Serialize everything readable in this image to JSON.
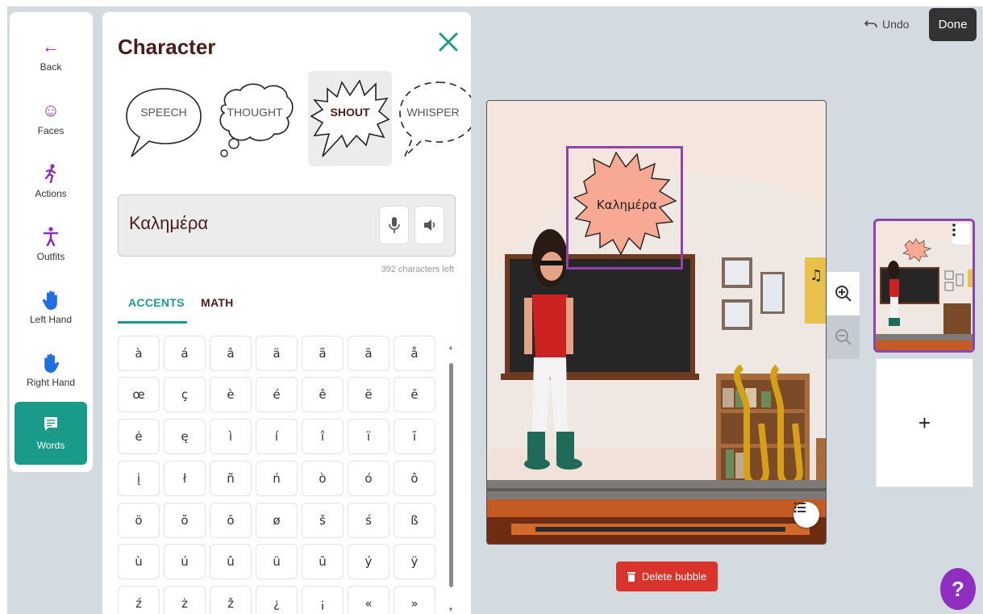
{
  "nav": {
    "items": [
      {
        "label": "Back",
        "icon": "back-arrow-icon"
      },
      {
        "label": "Faces",
        "icon": "face-icon"
      },
      {
        "label": "Actions",
        "icon": "running-person-icon"
      },
      {
        "label": "Outfits",
        "icon": "person-icon"
      },
      {
        "label": "Left Hand",
        "icon": "hand-icon"
      },
      {
        "label": "Right Hand",
        "icon": "hand-icon"
      },
      {
        "label": "Words",
        "icon": "speech-bubble-icon"
      }
    ],
    "active": "Words"
  },
  "panel": {
    "title": "Character",
    "bubble_types": [
      "SPEECH",
      "THOUGHT",
      "SHOUT",
      "WHISPER"
    ],
    "selected_bubble": "SHOUT",
    "text_value": "Καλημέρα",
    "chars_left": "392 characters left",
    "tabs": [
      "ACCENTS",
      "MATH"
    ],
    "active_tab": "ACCENTS",
    "accent_keys": [
      [
        "à",
        "á",
        "â",
        "ä",
        "ã",
        "ā",
        "å"
      ],
      [
        "œ",
        "ç",
        "è",
        "é",
        "ê",
        "ë",
        "ē"
      ],
      [
        "ė",
        "ę",
        "ì",
        "í",
        "î",
        "ï",
        "ī"
      ],
      [
        "į",
        "ł",
        "ñ",
        "ń",
        "ò",
        "ó",
        "ô"
      ],
      [
        "ö",
        "õ",
        "ō",
        "ø",
        "š",
        "ś",
        "ß"
      ],
      [
        "ù",
        "ú",
        "û",
        "ü",
        "ū",
        "ý",
        "ÿ"
      ],
      [
        "ź",
        "ż",
        "ž",
        "¿",
        "¡",
        "«",
        "»"
      ]
    ]
  },
  "scene": {
    "bubble_text": "Καλημέρα",
    "bubble_color": "#f7a993",
    "selection_color": "#8e44ad"
  },
  "actions": {
    "delete_label": "Delete bubble",
    "undo_label": "Undo",
    "done_label": "Done",
    "add_label": "+",
    "help_label": "?"
  },
  "colors": {
    "accent": "#1a9b8a",
    "danger": "#d9342b",
    "help": "#8e2fc0",
    "title": "#4a1d1d"
  }
}
